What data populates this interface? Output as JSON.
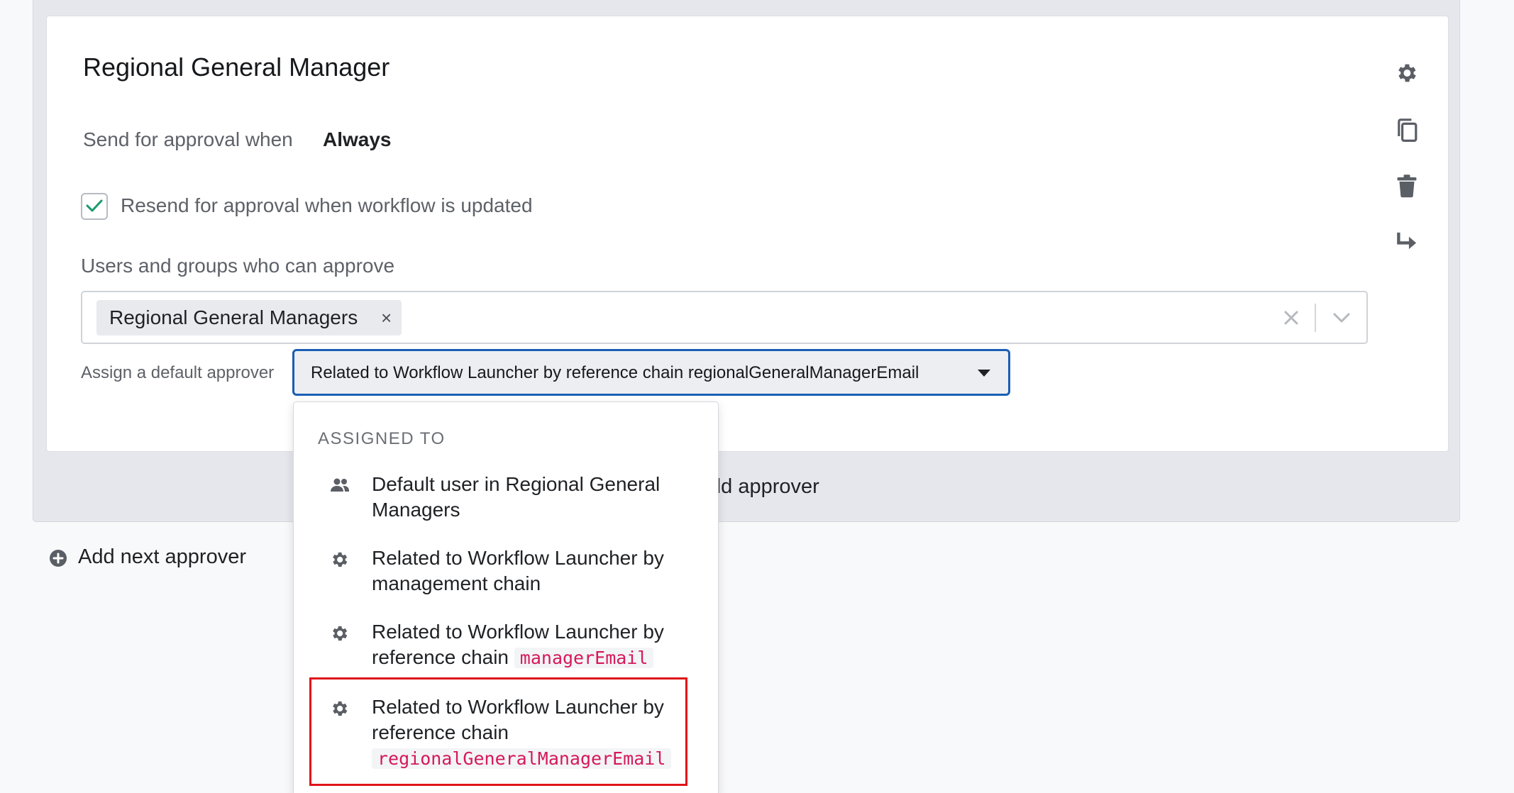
{
  "card": {
    "title": "Regional General Manager",
    "send_label": "Send for approval when",
    "send_value": "Always",
    "resend_checked": true,
    "resend_label": "Resend for approval when workflow is updated",
    "users_label": "Users and groups who can approve",
    "selected_groups": [
      "Regional General Managers"
    ],
    "tag_remove": "×",
    "assign_label": "Assign a default approver",
    "assign_value": "Related to Workflow Launcher by reference chain regionalGeneralManagerEmail"
  },
  "side_actions": [
    "gear-icon",
    "copy-icon",
    "trash-icon",
    "redirect-arrow-icon"
  ],
  "add_approver_label": "dd approver",
  "add_next_label": "Add next approver",
  "menu": {
    "heading": "ASSIGNED TO",
    "items": [
      {
        "icon": "users-icon",
        "line1": "Default user in Regional General",
        "line2": "Managers",
        "code": ""
      },
      {
        "icon": "gear-icon",
        "line1": "Related to Workflow Launcher by",
        "line2": "management chain",
        "code": ""
      },
      {
        "icon": "gear-icon",
        "line1": "Related to Workflow Launcher by",
        "line2": "reference chain",
        "code": "managerEmail"
      },
      {
        "icon": "gear-icon",
        "line1": "Related to Workflow Launcher by",
        "line2": "reference chain",
        "code": "regionalGeneralManagerEmail"
      }
    ]
  },
  "colors": {
    "focus_border": "#1a5fb4",
    "highlight_border": "#e0131a",
    "code_text": "#d6185a",
    "check": "#1a9a6c"
  }
}
